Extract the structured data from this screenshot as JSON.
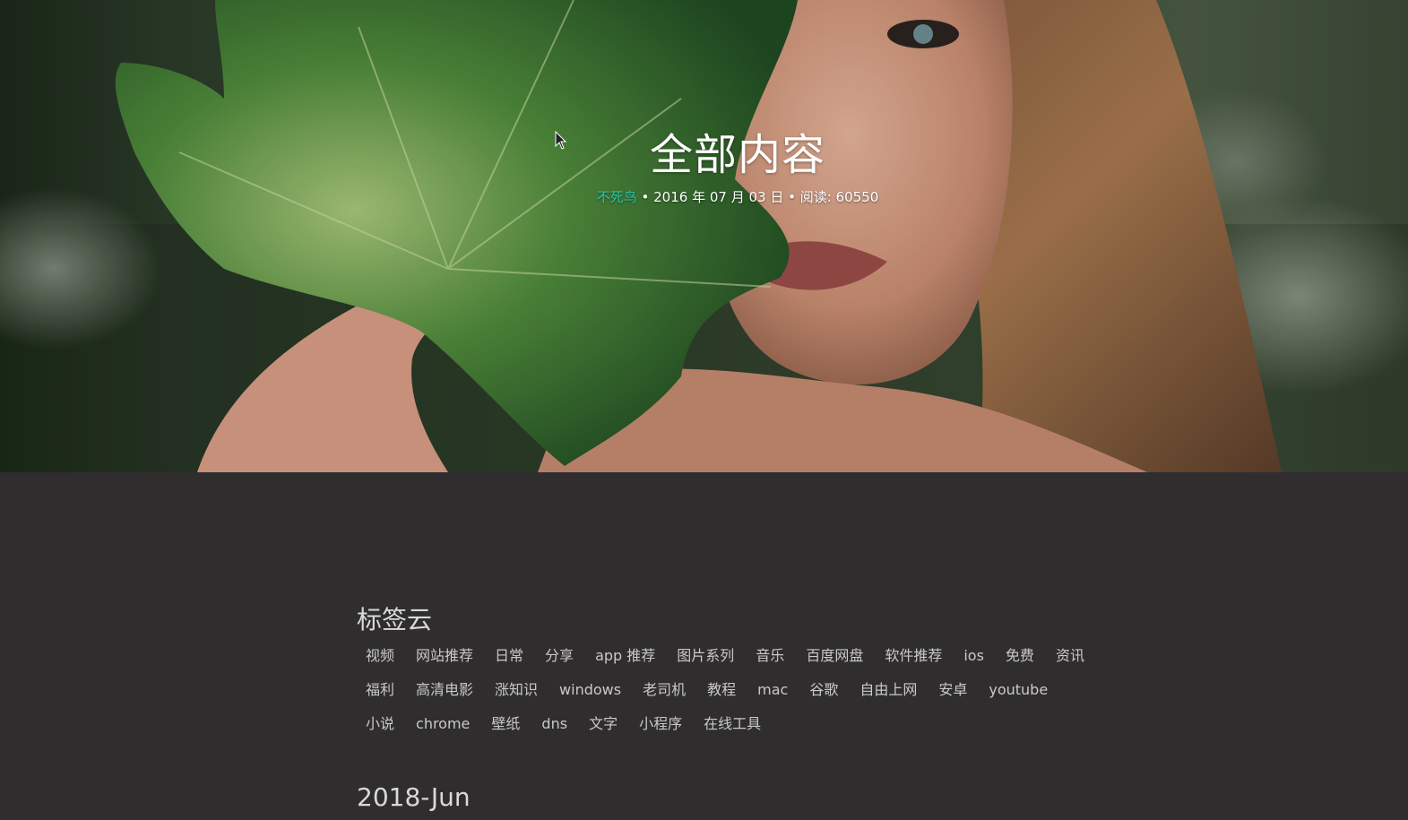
{
  "hero": {
    "title": "全部内容",
    "author": "不死鸟",
    "separator1": " • ",
    "date": "2016 年 07 月 03 日",
    "separator2": " • ",
    "reads": "阅读: 60550"
  },
  "tag_cloud": {
    "heading": "标签云",
    "tags": [
      "视频",
      "网站推荐",
      "日常",
      "分享",
      "app 推荐",
      "图片系列",
      "音乐",
      "百度网盘",
      "软件推荐",
      "ios",
      "免费",
      "资讯",
      "福利",
      "高清电影",
      "涨知识",
      "windows",
      "老司机",
      "教程",
      "mac",
      "谷歌",
      "自由上网",
      "安卓",
      "youtube",
      "小说",
      "chrome",
      "壁纸",
      "dns",
      "文字",
      "小程序",
      "在线工具"
    ]
  },
  "archive": {
    "month_heading": "2018-Jun"
  },
  "colors": {
    "background": "#2f2d2e",
    "author_accent": "#2bc4a6",
    "text": "#c9c9c9"
  }
}
